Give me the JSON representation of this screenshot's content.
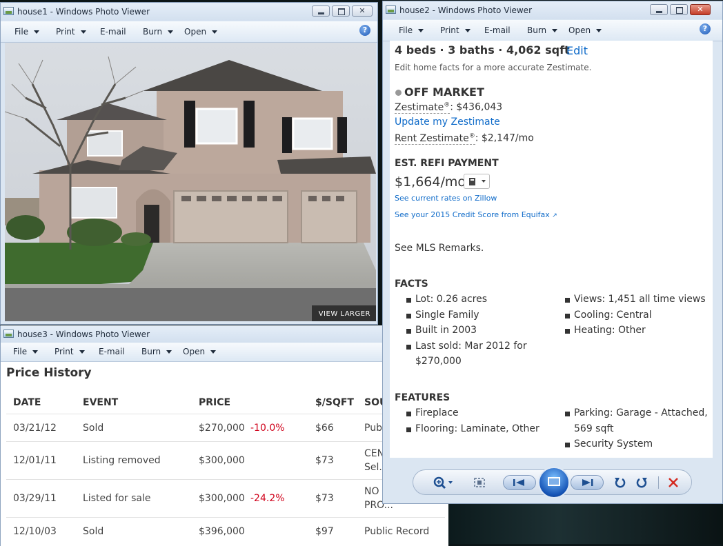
{
  "windows": {
    "house1": {
      "title": "house1 - Windows Photo Viewer"
    },
    "house2": {
      "title": "house2 - Windows Photo Viewer"
    },
    "house3": {
      "title": "house3 - Windows Photo Viewer"
    }
  },
  "menu": {
    "file": "File",
    "print": "Print",
    "email": "E-mail",
    "burn": "Burn",
    "open": "Open",
    "help": "?"
  },
  "photo": {
    "view_larger": "VIEW LARGER"
  },
  "home": {
    "summary": "4 beds · 3 baths · 4,062 sqft",
    "edit": "Edit",
    "edit_hint": "Edit home facts for a more accurate Zestimate.",
    "status": "OFF MARKET",
    "zestimate_label": "Zestimate",
    "zestimate_reg": "®",
    "zestimate_value": ": $436,043",
    "update_link": "Update my Zestimate",
    "rent_label": "Rent Zestimate",
    "rent_reg": "®",
    "rent_value": ": $2,147/mo",
    "refi_title": "EST. REFI PAYMENT",
    "refi_value": "$1,664/mo",
    "rates_link": "See current rates on Zillow",
    "credit_link": "See your 2015 Credit Score from Equifax",
    "mls": "See MLS Remarks.",
    "facts_title": "FACTS",
    "facts_left": [
      "Lot: 0.26 acres",
      "Single Family",
      "Built in 2003",
      "Last sold: Mar 2012 for",
      "$270,000"
    ],
    "facts_right": [
      "Views: 1,451 all time views",
      "Cooling: Central",
      "Heating: Other"
    ],
    "features_title": "FEATURES",
    "features_left": [
      "Fireplace",
      "Flooring: Laminate, Other"
    ],
    "features_right": [
      "Parking: Garage - Attached,",
      "569 sqft",
      "Security System"
    ]
  },
  "price_history": {
    "title": "Price History",
    "headers": [
      "DATE",
      "EVENT",
      "PRICE",
      "$/SQFT",
      "SOU"
    ],
    "rows": [
      {
        "date": "03/21/12",
        "event": "Sold",
        "price": "$270,000",
        "change": "-10.0%",
        "sqft": "$66",
        "source": "Pub",
        "source2": ""
      },
      {
        "date": "12/01/11",
        "event": "Listing removed",
        "price": "$300,000",
        "change": "",
        "sqft": "$73",
        "source": "CEN",
        "source2": "Sel."
      },
      {
        "date": "03/29/11",
        "event": "Listed for sale",
        "price": "$300,000",
        "change": "-24.2%",
        "sqft": "$73",
        "source": "NO",
        "source2": "PRO..."
      },
      {
        "date": "12/10/03",
        "event": "Sold",
        "price": "$396,000",
        "change": "",
        "sqft": "$97",
        "source": "Public Record",
        "source2": ""
      }
    ]
  }
}
